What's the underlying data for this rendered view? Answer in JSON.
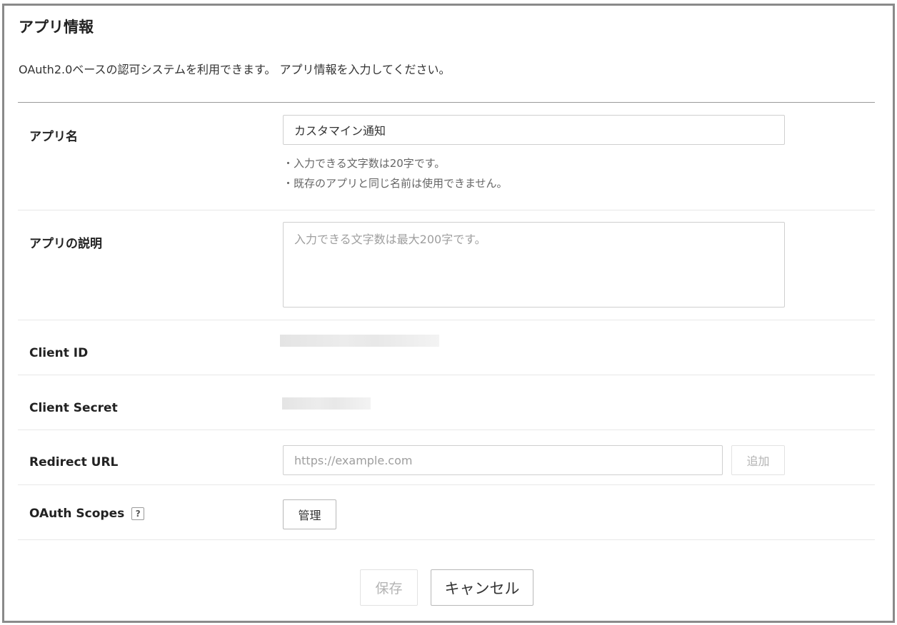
{
  "page": {
    "title": "アプリ情報",
    "description": "OAuth2.0ベースの認可システムを利用できます。 アプリ情報を入力してください。"
  },
  "form": {
    "app_name": {
      "label": "アプリ名",
      "value": "カスタマイン通知",
      "hints": [
        "・入力できる文字数は20字です。",
        "・既存のアプリと同じ名前は使用できません。"
      ]
    },
    "app_description": {
      "label": "アプリの説明",
      "value": "",
      "placeholder": "入力できる文字数は最大200字です。"
    },
    "client_id": {
      "label": "Client ID"
    },
    "client_secret": {
      "label": "Client Secret"
    },
    "redirect_url": {
      "label": "Redirect URL",
      "value": "",
      "placeholder": "https://example.com",
      "add_button": "追加"
    },
    "oauth_scopes": {
      "label": "OAuth Scopes",
      "help_icon": "?",
      "manage_button": "管理"
    }
  },
  "actions": {
    "save": "保存",
    "cancel": "キャンセル"
  }
}
